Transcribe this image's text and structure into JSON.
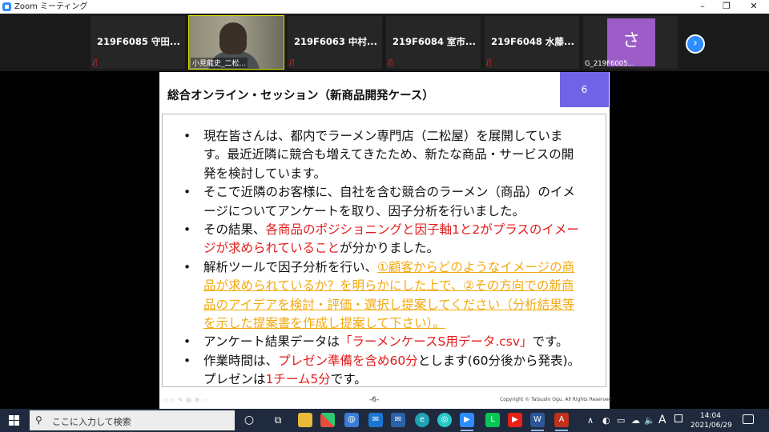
{
  "window": {
    "title": "Zoom ミーティング",
    "minimize": "–",
    "maximize": "❐",
    "close": "✕"
  },
  "participants": [
    {
      "name": "219F6085 守田..."
    },
    {
      "name": "小見龍史_二松..."
    },
    {
      "name": "219F6063 中村..."
    },
    {
      "name": "219F6084 室市..."
    },
    {
      "name": "219F6048 水藤..."
    },
    {
      "avatar": "さ",
      "name": "G_219F6005..."
    }
  ],
  "strip_next": "›",
  "slide": {
    "title": "総合オンライン・セッション（新商品開発ケース）",
    "number": "6",
    "bullets": [
      {
        "text": "現在皆さんは、都内でラーメン専門店（二松屋）を展開しています。最近近隣に競合も増えてきたため、新たな商品・サービスの開発を検討しています。"
      },
      {
        "text": "そこで近隣のお客様に、自社を含む競合のラーメン（商品）のイメージについてアンケートを取り、因子分析を行いました。"
      },
      {
        "pre": "その結果、",
        "red": "各商品のポジショニングと因子軸1と2がプラスのイメージが求められていること",
        "post": "が分かりました。"
      },
      {
        "pre": "解析ツールで因子分析を行い、",
        "orange": "①顧客からどのようなイメージの商品が求められているか？を明らかにした上で、②その方向での新商品のアイデアを検討・評価・選択し提案してください（分析結果等を示した提案書を作成し提案して下さい）。"
      },
      {
        "pre": "アンケート結果データは",
        "red": "「ラーメンケースS用データ.csv」",
        "post": "です。"
      },
      {
        "pre": "作業時間は、",
        "red": "プレゼン準備を含め60分",
        "mid": "とします(60分後から発表)。プレゼンは",
        "red2": "1チーム5分",
        "post": "です。"
      }
    ],
    "footer_page": "-6-",
    "copyright": "Copyright © Tatsushi Ogu. All Rights Reserved"
  },
  "taskbar": {
    "search_placeholder": "ここに入力して検索",
    "time": "14:04",
    "date": "2021/06/29",
    "ime": "A"
  }
}
